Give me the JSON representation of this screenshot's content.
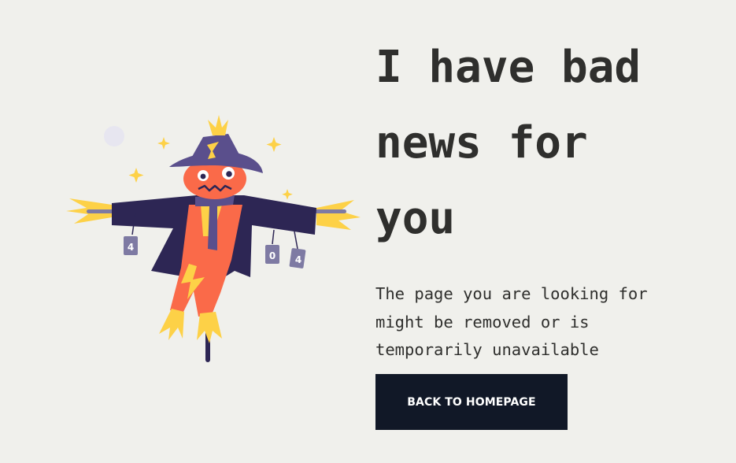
{
  "headline": {
    "line1": "I have bad",
    "line2": "news for",
    "line3": "you"
  },
  "message": "The page you are looking for might be removed or is temporarily unavailable",
  "button": {
    "label": "BACK TO HOMEPAGE"
  },
  "illustration": {
    "subject": "scarecrow",
    "cans": [
      "4",
      "0",
      "4"
    ]
  },
  "colors": {
    "background": "#f0f0ec",
    "text": "#2f2f2d",
    "button": "#111827",
    "button_text": "#ffffff",
    "accent_orange": "#fa6a49",
    "accent_yellow": "#fdd147",
    "purple": "#5a4f8c",
    "navy": "#2d2654"
  }
}
